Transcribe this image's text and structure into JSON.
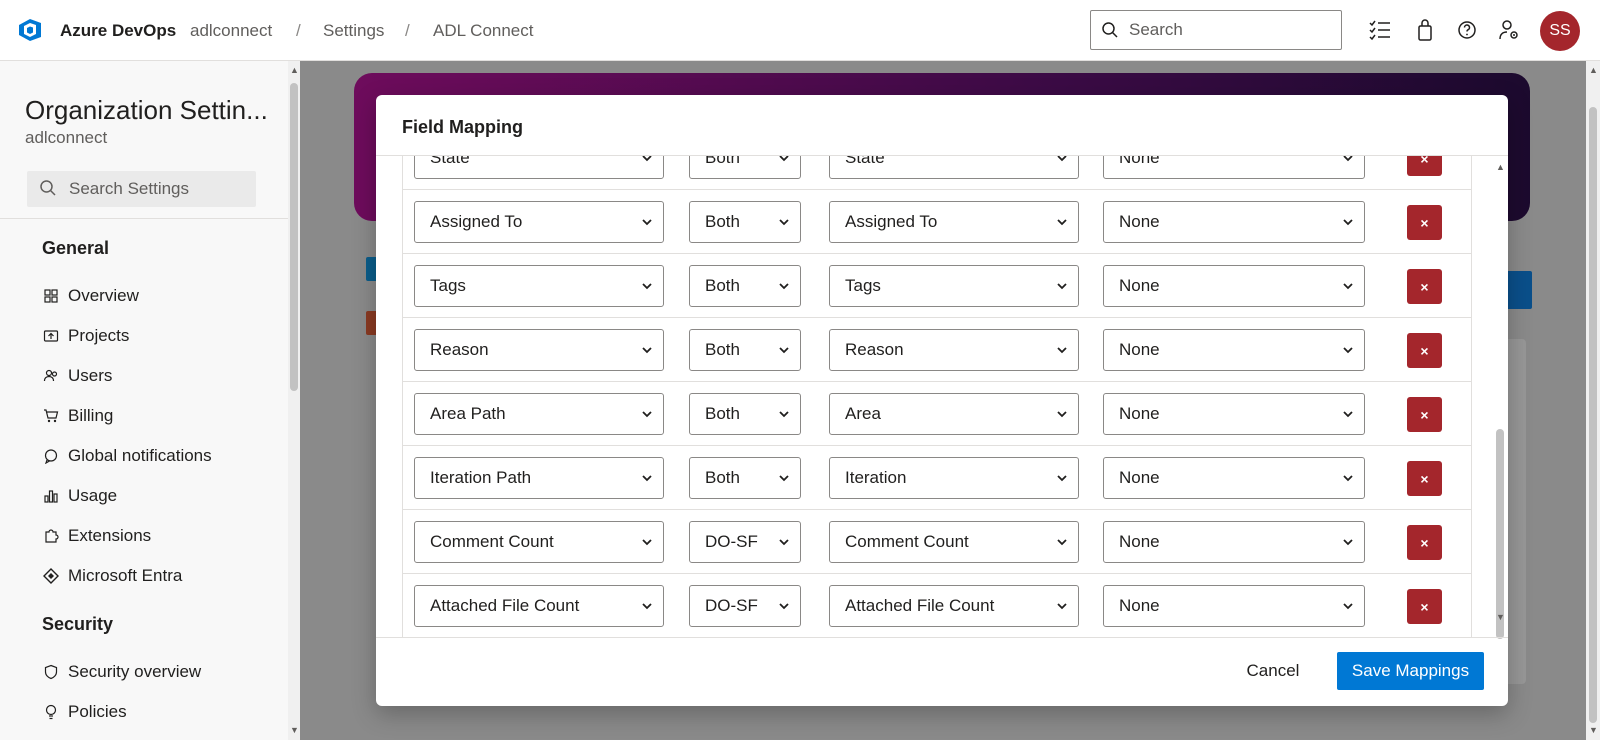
{
  "header": {
    "brand": "Azure DevOps",
    "breadcrumb": [
      "adlconnect",
      "Settings",
      "ADL Connect"
    ],
    "search_placeholder": "Search",
    "avatar_initials": "SS",
    "icons": [
      "checklist-icon",
      "shopping-bag-icon",
      "help-icon",
      "user-settings-icon"
    ]
  },
  "sidebar": {
    "title": "Organization Settin...",
    "subtitle": "adlconnect",
    "search_placeholder": "Search Settings",
    "sections": [
      {
        "title": "General",
        "items": [
          {
            "label": "Overview",
            "icon": "overview-icon"
          },
          {
            "label": "Projects",
            "icon": "projects-icon"
          },
          {
            "label": "Users",
            "icon": "users-icon"
          },
          {
            "label": "Billing",
            "icon": "cart-icon"
          },
          {
            "label": "Global notifications",
            "icon": "chat-icon"
          },
          {
            "label": "Usage",
            "icon": "usage-icon"
          },
          {
            "label": "Extensions",
            "icon": "puzzle-icon"
          },
          {
            "label": "Microsoft Entra",
            "icon": "entra-icon"
          }
        ]
      },
      {
        "title": "Security",
        "items": [
          {
            "label": "Security overview",
            "icon": "shield-icon"
          },
          {
            "label": "Policies",
            "icon": "bulb-icon"
          }
        ]
      }
    ]
  },
  "dialog": {
    "title": "Field Mapping",
    "rows": [
      {
        "source": "State",
        "direction": "Both",
        "target": "State",
        "transform": "None"
      },
      {
        "source": "Assigned To",
        "direction": "Both",
        "target": "Assigned To",
        "transform": "None"
      },
      {
        "source": "Tags",
        "direction": "Both",
        "target": "Tags",
        "transform": "None"
      },
      {
        "source": "Reason",
        "direction": "Both",
        "target": "Reason",
        "transform": "None"
      },
      {
        "source": "Area Path",
        "direction": "Both",
        "target": "Area",
        "transform": "None"
      },
      {
        "source": "Iteration Path",
        "direction": "Both",
        "target": "Iteration",
        "transform": "None"
      },
      {
        "source": "Comment Count",
        "direction": "DO-SF",
        "target": "Comment Count",
        "transform": "None"
      },
      {
        "source": "Attached File Count",
        "direction": "DO-SF",
        "target": "Attached File Count",
        "transform": "None"
      }
    ],
    "delete_glyph": "×",
    "cancel_label": "Cancel",
    "save_label": "Save Mappings"
  },
  "colors": {
    "accent": "#0078d4",
    "danger": "#a4262c",
    "avatar": "#a4262c"
  }
}
